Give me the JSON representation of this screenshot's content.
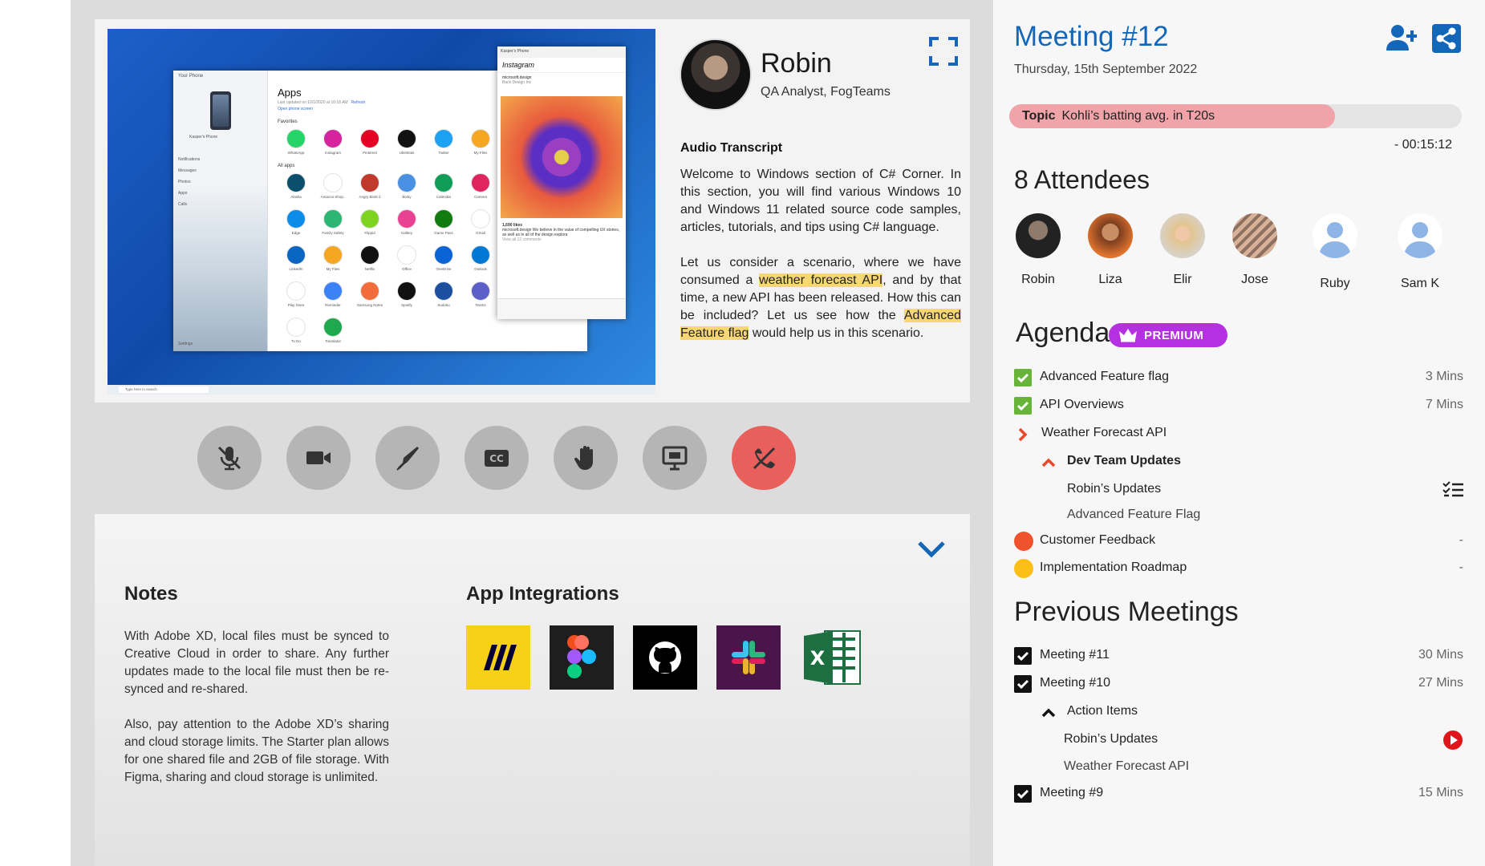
{
  "presenter": {
    "name": "Robin",
    "role": "QA Analyst, FogTeams"
  },
  "transcript": {
    "title": "Audio Transcript",
    "p1": "Welcome to Windows section of C# Corner. In this section, you will find various Windows 10 and Windows 11 related source code samples, articles, tutorials, and tips using C# language.",
    "p2_a": "Let us consider a scenario, where we have consumed a ",
    "p2_hl1": "weather forecast API",
    "p2_b": ", and by that time, a new API has been released. How this can be included?  Let us see how the ",
    "p2_hl2": "Advanced Feature flag",
    "p2_c": " would help us in this scenario."
  },
  "shared_screen": {
    "window_title": "Your Phone",
    "phone_name": "Kasper's Phone",
    "apps_title": "Apps",
    "apps_updated": "Last updated on 10/1/2020 at 10:18 AM",
    "refresh": "Refresh",
    "open_phone_screen": "Open phone screen",
    "favorites": "Favorites",
    "all_apps": "All apps",
    "nav": [
      "Notifications",
      "Messages",
      "Photos",
      "Apps",
      "Calls"
    ],
    "settings": "Settings",
    "phone_app": "Instagram",
    "post_account": "microsoft.design",
    "post_sub": "Back Design Inc",
    "likes": "1,690 likes",
    "caption": "microsoft.design We believe in the value of compelling UX stories, as well as in all of the design explora",
    "view_comments": "View all 12 comments",
    "search": "Type here to search",
    "apps": [
      {
        "name": "WhatsApp",
        "color": "#25d366"
      },
      {
        "name": "Instagram",
        "color": "#d6249f"
      },
      {
        "name": "Pinterest",
        "color": "#e60023"
      },
      {
        "name": "UberEats",
        "color": "#111111"
      },
      {
        "name": "Twitter",
        "color": "#1da1f2"
      },
      {
        "name": "My Files",
        "color": "#f5a623"
      },
      {
        "name": "Alaska",
        "color": "#0b4f6c"
      },
      {
        "name": "Amazon Shop..",
        "color": "#ffffff"
      },
      {
        "name": "Angry Birds 2",
        "color": "#c0392b"
      },
      {
        "name": "Bixby",
        "color": "#4a90e2"
      },
      {
        "name": "Calendar",
        "color": "#0f9d58"
      },
      {
        "name": "Camera",
        "color": "#e0245e"
      },
      {
        "name": "Edge",
        "color": "#0c8ce9"
      },
      {
        "name": "Family Safety",
        "color": "#2bb673"
      },
      {
        "name": "Flippid",
        "color": "#7ed321"
      },
      {
        "name": "Gallery",
        "color": "#e84393"
      },
      {
        "name": "Game Pass",
        "color": "#107c10"
      },
      {
        "name": "Gmail",
        "color": "#ffffff"
      },
      {
        "name": "LinkedIn",
        "color": "#0a66c2"
      },
      {
        "name": "My Files",
        "color": "#f5a623"
      },
      {
        "name": "Netflix",
        "color": "#111111"
      },
      {
        "name": "Office",
        "color": "#ffffff"
      },
      {
        "name": "OneDrive",
        "color": "#0a64d6"
      },
      {
        "name": "Outlook",
        "color": "#0078d4"
      },
      {
        "name": "Play Store",
        "color": "#ffffff"
      },
      {
        "name": "Reminder",
        "color": "#3b82f6"
      },
      {
        "name": "Samsung Notes",
        "color": "#f26b3a"
      },
      {
        "name": "Spotify",
        "color": "#111111"
      },
      {
        "name": "Sudoku",
        "color": "#1c4fa0"
      },
      {
        "name": "Teams",
        "color": "#5b5fc7"
      },
      {
        "name": "To Do",
        "color": "#ffffff"
      },
      {
        "name": "Translator",
        "color": "#20a84f"
      }
    ]
  },
  "notes": {
    "title": "Notes",
    "p1": "With Adobe XD, local files must be synced to Creative Cloud in order to share. Any further updates made to the local file must then be re-synced and re-shared.",
    "p2": "Also, pay attention to the Adobe XD’s sharing and cloud storage limits. The Starter plan allows for one shared file and 2GB of file storage. With Figma, sharing and cloud storage is unlimited."
  },
  "integrations": {
    "title": "App Integrations",
    "items": [
      {
        "icon": "miro-icon",
        "bg": "#f7d117"
      },
      {
        "icon": "figma-icon",
        "bg": "#1e1e1e"
      },
      {
        "icon": "github-icon",
        "bg": "#000000"
      },
      {
        "icon": "slack-icon",
        "bg": "#4a154b"
      },
      {
        "icon": "excel-icon",
        "bg": "#ffffff"
      }
    ]
  },
  "meeting": {
    "title": "Meeting #12",
    "date": "Thursday, 15th September 2022",
    "topic_label": "Topic",
    "topic": "Kohli’s batting avg. in T20s",
    "topic_progress": 0.72,
    "timer": "- 00:15:12"
  },
  "attendees": {
    "title": "8 Attendees",
    "people": [
      {
        "name": "Robin",
        "color": "#2a2a2a"
      },
      {
        "name": "Liza",
        "color": "#9b5a34"
      },
      {
        "name": "Elir",
        "color": "#d8b896"
      },
      {
        "name": "Jose",
        "color": "#c79a7a"
      },
      {
        "name": "Ruby",
        "color": "#dfe8f5"
      },
      {
        "name": "Sam K",
        "color": "#dfe8f5"
      }
    ]
  },
  "agenda": {
    "title": "Agenda",
    "badge": "PREMIUM",
    "items": [
      {
        "label": "Advanced Feature flag",
        "duration": "3 Mins"
      },
      {
        "label": "API Overviews",
        "duration": "7 Mins"
      },
      {
        "label": "Weather Forecast API"
      },
      {
        "label": "Dev Team Updates"
      },
      {
        "label": "Robin’s Updates"
      },
      {
        "label": "Advanced Feature Flag"
      },
      {
        "label": "Customer Feedback",
        "duration": "-",
        "color": "#f0522e"
      },
      {
        "label": "Implementation Roadmap",
        "duration": "-",
        "color": "#fbbf18"
      }
    ]
  },
  "previous": {
    "title": "Previous Meetings",
    "items": [
      {
        "label": "Meeting #11",
        "duration": "30 Mins"
      },
      {
        "label": "Meeting #10",
        "duration": "27 Mins"
      },
      {
        "label": "Action Items"
      },
      {
        "label": "Robin’s Updates"
      },
      {
        "label": "Weather Forecast API"
      },
      {
        "label": "Meeting #9",
        "duration": "15 Mins"
      }
    ]
  },
  "colors": {
    "accent": "#1467b8",
    "end_call": "#e85f5c",
    "premium": "#b530e0",
    "highlight": "#f7d775",
    "topic_fill": "#f0a3a8"
  }
}
